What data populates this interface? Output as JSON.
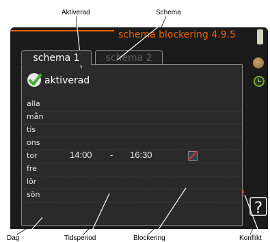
{
  "callouts": {
    "aktiverad": "Aktiverad",
    "schema": "Schema",
    "dag": "Dag",
    "tidsperiod": "Tidsperiod",
    "blockering": "Blockering",
    "konflikt": "Konflikt"
  },
  "header": {
    "title": "schema blockering 4.9.5"
  },
  "tabs": [
    {
      "label": "schema 1",
      "active": true
    },
    {
      "label": "schema 2",
      "active": false
    }
  ],
  "activated": {
    "checked": true,
    "label": "aktiverad"
  },
  "days": [
    {
      "label": "alla"
    },
    {
      "label": "mån"
    },
    {
      "label": "tis"
    },
    {
      "label": "ons"
    },
    {
      "label": "tor",
      "start": "14:00",
      "separator": "-",
      "end": "16:30",
      "blocking": true,
      "conflict": "!"
    },
    {
      "label": "fre"
    },
    {
      "label": "lör"
    },
    {
      "label": "sön"
    }
  ],
  "icons": {
    "help": "?",
    "side": [
      "face-icon",
      "clock-icon"
    ]
  },
  "colors": {
    "accent": "#e8630c",
    "screen_bg": "#1b1b1b",
    "check": "#3fae2a",
    "conflict": "#e0201a"
  }
}
